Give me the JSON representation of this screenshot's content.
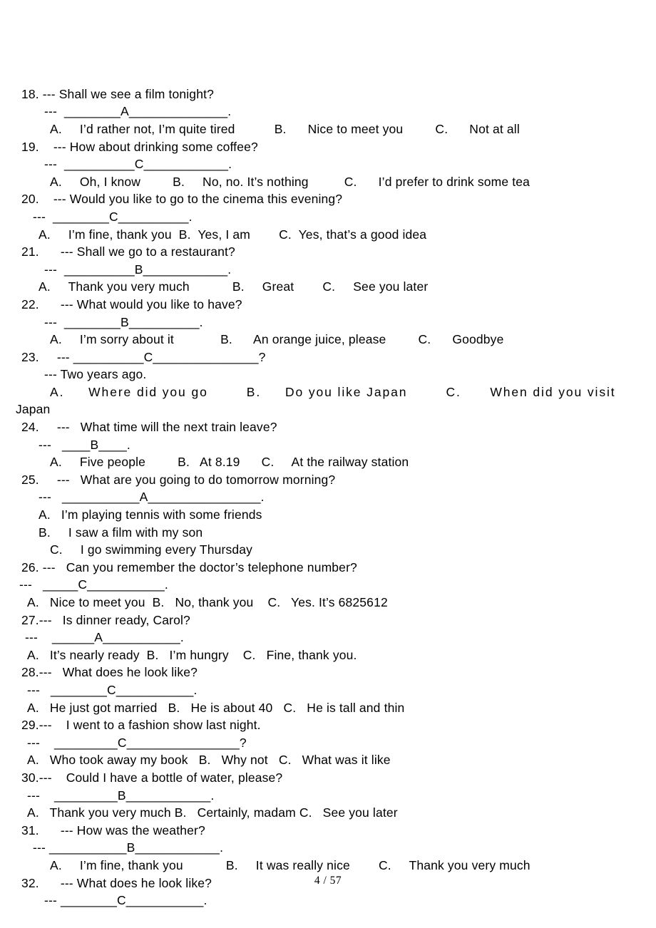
{
  "document": {
    "page_label": "4 / 57",
    "page_number": "4",
    "total_pages": "57",
    "dash_marker": "---"
  },
  "lines": [
    {
      "id": "q18-stem",
      "indent": 1,
      "text": "18. --- Shall we see a film tonight?"
    },
    {
      "id": "q18-answer",
      "indent": 5,
      "text": "---  ________A______________."
    },
    {
      "id": "q18-options",
      "indent": 6,
      "text": "A.     I’d rather not, I’m quite tired           B.      Nice to meet you         C.      Not at all"
    },
    {
      "id": "q19-stem",
      "indent": 1,
      "text": "19.    --- How about drinking some coffee?"
    },
    {
      "id": "q19-answer",
      "indent": 5,
      "text": "---  __________C____________."
    },
    {
      "id": "q19-options",
      "indent": 6,
      "text": "A.     Oh, I know         B.     No, no. It’s nothing          C.      I’d prefer to drink some tea"
    },
    {
      "id": "q20-stem",
      "indent": 1,
      "text": "20.    --- Would you like to go to the cinema this evening?"
    },
    {
      "id": "q20-answer",
      "indent": 3,
      "text": "---  ________C__________."
    },
    {
      "id": "q20-options",
      "indent": 4,
      "text": "A.     I’m fine, thank you  B.  Yes, I am        C.  Yes, that’s a good idea"
    },
    {
      "id": "q21-stem",
      "indent": 1,
      "text": "21.      --- Shall we go to a restaurant?"
    },
    {
      "id": "q21-answer",
      "indent": 5,
      "text": "---  __________B____________."
    },
    {
      "id": "q21-options",
      "indent": 4,
      "text": "A.     Thank you very much            B.     Great        C.     See you later"
    },
    {
      "id": "q22-stem",
      "indent": 1,
      "text": "22.      --- What would you like to have?"
    },
    {
      "id": "q22-answer",
      "indent": 5,
      "text": "---  ________B__________."
    },
    {
      "id": "q22-options",
      "indent": 6,
      "text": "A.     I’m sorry about it             B.      An orange juice, please         C.      Goodbye"
    },
    {
      "id": "q23-answer",
      "indent": 1,
      "text": "23.     --- __________C_______________?"
    },
    {
      "id": "q23-stem",
      "indent": 5,
      "text": "--- Two years ago."
    },
    {
      "id": "q23-options",
      "indent": 6,
      "text": "A.     Where did you go        B.     Do you like Japan        C.      When did you visit",
      "wide": true
    },
    {
      "id": "q23-options-cont",
      "indent": 0,
      "text": "Japan"
    },
    {
      "id": "q24-stem",
      "indent": 1,
      "text": "24.     ---   What time will the next train leave?"
    },
    {
      "id": "q24-answer",
      "indent": 4,
      "text": "---   ____B____."
    },
    {
      "id": "q24-options",
      "indent": 6,
      "text": "A.     Five people         B.   At 8.19      C.     At the railway station"
    },
    {
      "id": "q25-stem",
      "indent": 1,
      "text": "25.     ---   What are you going to do tomorrow morning?"
    },
    {
      "id": "q25-answer",
      "indent": 4,
      "text": "---   ___________A________________."
    },
    {
      "id": "q25-option-a",
      "indent": 4,
      "text": "A.   I’m playing tennis with some friends"
    },
    {
      "id": "q25-option-b",
      "indent": 4,
      "text": "B.     I saw a film with my son"
    },
    {
      "id": "q25-option-c",
      "indent": 6,
      "text": "C.     I go swimming every Thursday"
    },
    {
      "id": "q26-stem",
      "indent": 1,
      "text": "26. ---   Can you remember the doctor’s telephone number?"
    },
    {
      "id": "q26-answer",
      "indent": 0,
      "text": " ---   _____C___________."
    },
    {
      "id": "q26-options",
      "indent": 2,
      "text": "A.   Nice to meet you  B.   No, thank you    C.   Yes. It’s 6825612"
    },
    {
      "id": "q27-stem",
      "indent": 1,
      "text": "27.---   Is dinner ready, Carol?"
    },
    {
      "id": "q27-answer",
      "indent": 1,
      "text": " ---    ______A___________."
    },
    {
      "id": "q27-options",
      "indent": 2,
      "text": "A.   It’s nearly ready  B.   I’m hungry    C.   Fine, thank you."
    },
    {
      "id": "q28-stem",
      "indent": 1,
      "text": "28.---   What does he look like?"
    },
    {
      "id": "q28-answer",
      "indent": 2,
      "text": "---   ________C___________."
    },
    {
      "id": "q28-options",
      "indent": 2,
      "text": "A.   He just got married   B.   He is about 40   C.   He is tall and thin"
    },
    {
      "id": "q29-stem",
      "indent": 1,
      "text": "29.---    I went to a fashion show last night."
    },
    {
      "id": "q29-answer",
      "indent": 2,
      "text": "---    _________C________________?"
    },
    {
      "id": "q29-options",
      "indent": 2,
      "text": "A.   Who took away my book   B.   Why not   C.   What was it like"
    },
    {
      "id": "q30-stem",
      "indent": 1,
      "text": "30.---    Could I have a bottle of water, please?"
    },
    {
      "id": "q30-answer",
      "indent": 2,
      "text": "---    _________B____________."
    },
    {
      "id": "q30-options",
      "indent": 2,
      "text": "A.   Thank you very much B.   Certainly, madam C.   See you later"
    },
    {
      "id": "q31-stem",
      "indent": 1,
      "text": "31.      --- How was the weather?"
    },
    {
      "id": "q31-answer",
      "indent": 3,
      "text": "--- ___________B____________."
    },
    {
      "id": "q31-options",
      "indent": 6,
      "text": "A.     I’m fine, thank you            B.     It was really nice        C.     Thank you very much"
    },
    {
      "id": "q32-stem",
      "indent": 1,
      "text": "32.      --- What does he look like?"
    },
    {
      "id": "q32-answer",
      "indent": 5,
      "text": "--- ________C___________."
    }
  ]
}
